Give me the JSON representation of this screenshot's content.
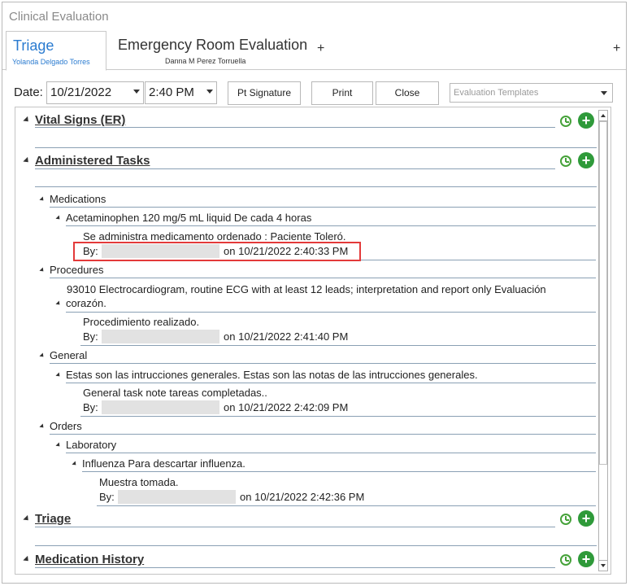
{
  "window": {
    "title": "Clinical Evaluation"
  },
  "tabs": [
    {
      "title": "Triage",
      "subtitle": "Yolanda Delgado Torres"
    },
    {
      "title": "Emergency Room Evaluation",
      "subtitle": "Danna M Perez Torruella"
    }
  ],
  "tab_plus": "+",
  "toolbar": {
    "date_label": "Date:",
    "date_value": "10/21/2022",
    "time_value": "2:40 PM",
    "pt_signature": "Pt Signature",
    "print": "Print",
    "close": "Close",
    "templates_placeholder": "Evaluation Templates"
  },
  "sections": {
    "vital_signs": "Vital Signs (ER)",
    "administered_tasks": "Administered Tasks",
    "triage": "Triage",
    "medication_history": "Medication History"
  },
  "tasks": {
    "medications_label": "Medications",
    "acetaminophen": "Acetaminophen 120 mg/5 mL liquid  De cada 4 horas",
    "acet_note": "Se administra medicamento ordenado : Paciente Toleró.",
    "acet_by": "By:",
    "acet_on": "on 10/21/2022 2:40:33 PM",
    "procedures_label": "Procedures",
    "ecg_line1": "93010 Electrocardiogram, routine ECG with at least 12 leads; interpretation and report only Evaluación",
    "ecg_line2": "corazón.",
    "ecg_note": "Procedimiento realizado.",
    "ecg_by": "By:",
    "ecg_on": "on 10/21/2022 2:41:40 PM",
    "general_label": "General",
    "general_item": "Estas son las intrucciones generales.  Estas son las notas de las intrucciones generales.",
    "general_note": "General task note tareas completadas..",
    "general_by": "By:",
    "general_on": "on 10/21/2022 2:42:09 PM",
    "orders_label": "Orders",
    "laboratory_label": "Laboratory",
    "influenza": "Influenza Para descartar influenza.",
    "influenza_note": "Muestra tomada.",
    "influenza_by": "By:",
    "influenza_on": "on 10/21/2022 2:42:36 PM"
  },
  "icons": {
    "alarm": "alarm-clock-icon",
    "add": "add-circle-icon",
    "add_color": "#2f9a3a",
    "alarm_color": "#46a23a",
    "highlight_color": "#e33a3a",
    "tab_accent": "#2a7bd0"
  }
}
